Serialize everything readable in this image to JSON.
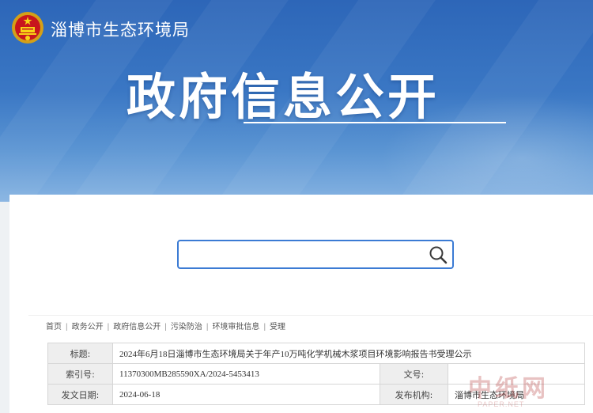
{
  "header": {
    "site_name": "淄博市生态环境局",
    "page_title": "政府信息公开"
  },
  "search": {
    "value": "",
    "placeholder": ""
  },
  "breadcrumb": [
    "首页",
    "政务公开",
    "政府信息公开",
    "污染防治",
    "环境审批信息",
    "受理"
  ],
  "info": {
    "title_label": "标题:",
    "title_value": "2024年6月18日淄博市生态环境局关于年产10万吨化学机械木浆项目环境影响报告书受理公示",
    "index_label": "索引号:",
    "index_value": "11370300MB285590XA/2024-5453413",
    "docno_label": "文号:",
    "docno_value": "",
    "date_label": "发文日期:",
    "date_value": "2024-06-18",
    "org_label": "发布机构:",
    "org_value": "淄博市生态环境局"
  },
  "watermark": {
    "main": "中纸网",
    "sub": "PAPER.NET"
  },
  "colors": {
    "banner_top": "#2d66b8",
    "banner_bottom": "#86b3e2",
    "search_border": "#3b7bd4",
    "label_bg": "#eeeeee"
  },
  "icons": {
    "emblem": "national-emblem-icon",
    "search": "search-icon"
  }
}
